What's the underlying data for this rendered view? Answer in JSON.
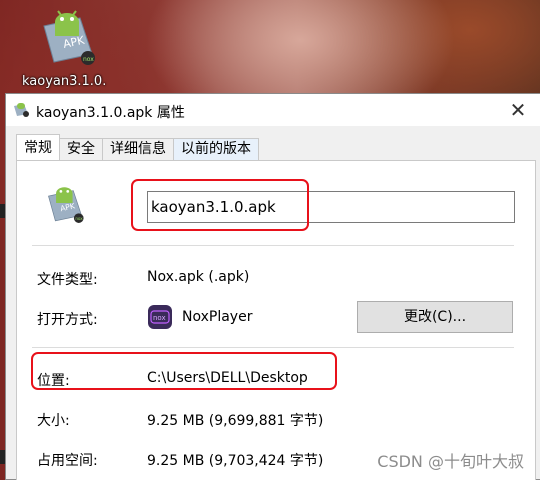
{
  "desktop": {
    "icon_label": "kaoyan3.1.0."
  },
  "dialog": {
    "title": "kaoyan3.1.0.apk 属性",
    "close_glyph": "✕",
    "tabs": [
      {
        "label": "常规",
        "active": true
      },
      {
        "label": "安全",
        "active": false
      },
      {
        "label": "详细信息",
        "active": false
      },
      {
        "label": "以前的版本",
        "active": false
      }
    ]
  },
  "general": {
    "file_name": "kaoyan3.1.0.apk",
    "rows": {
      "file_type": {
        "label": "文件类型:",
        "value": "Nox.apk (.apk)"
      },
      "open_with": {
        "label": "打开方式:",
        "value": "NoxPlayer",
        "button": "更改(C)..."
      },
      "location": {
        "label": "位置:",
        "value": "C:\\Users\\DELL\\Desktop"
      },
      "size": {
        "label": "大小:",
        "value": "9.25 MB (9,699,881 字节)"
      },
      "size_on_disk": {
        "label": "占用空间:",
        "value": "9.25 MB (9,703,424 字节)"
      }
    }
  },
  "watermark": "CSDN @十旬叶大叔",
  "colors": {
    "highlight_box": "#e8111a",
    "android_green": "#8bc34a",
    "apk_folder": "#8fa3b8",
    "nox_bg": "#3a2a5a"
  }
}
